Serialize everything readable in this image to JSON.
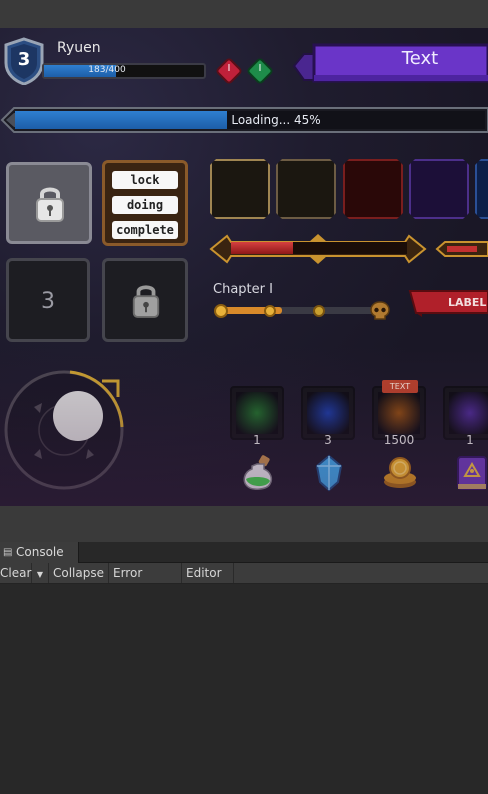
{
  "player": {
    "level": "3",
    "name": "Ryuen",
    "hp_text": "183/400",
    "hp_fraction": 0.45
  },
  "gems": [
    {
      "label": "I",
      "color": "#c0213a"
    },
    {
      "label": "I",
      "color": "#1e8c4a"
    }
  ],
  "banner": {
    "text": "Text",
    "color": "#6a35c8"
  },
  "loading": {
    "text": "Loading... 45%",
    "fraction": 0.45
  },
  "lock_panel": {
    "slot_number": "3",
    "buttons": [
      "lock",
      "doing",
      "complete"
    ]
  },
  "frames": [
    {
      "color": "#a08652"
    },
    {
      "color": "#6d5c44"
    },
    {
      "color": "#7a1e1e"
    },
    {
      "color": "#4c2f8a"
    },
    {
      "color": "#2a4f95"
    }
  ],
  "ornate_bar": {
    "fraction": 0.35
  },
  "chapter": {
    "title": "Chapter I",
    "progress": 0.4
  },
  "label_ribbon": {
    "text": "LABEL"
  },
  "items": [
    {
      "count": "1",
      "color": "#1f6d2a",
      "icon": "green-potion-icon",
      "badge": ""
    },
    {
      "count": "3",
      "color": "#1a3aa0",
      "icon": "blue-crystal-icon",
      "badge": ""
    },
    {
      "count": "1500",
      "color": "#8a4a10",
      "icon": "gold-coins-icon",
      "badge": "TEXT"
    },
    {
      "count": "1",
      "color": "#4a2a90",
      "icon": "spell-book-icon",
      "badge": ""
    }
  ],
  "console": {
    "tab_label": "Console",
    "toolbar": {
      "clear": "Clear",
      "collapse": "Collapse",
      "error_pause": "Error Pause",
      "editor": "Editor"
    }
  }
}
